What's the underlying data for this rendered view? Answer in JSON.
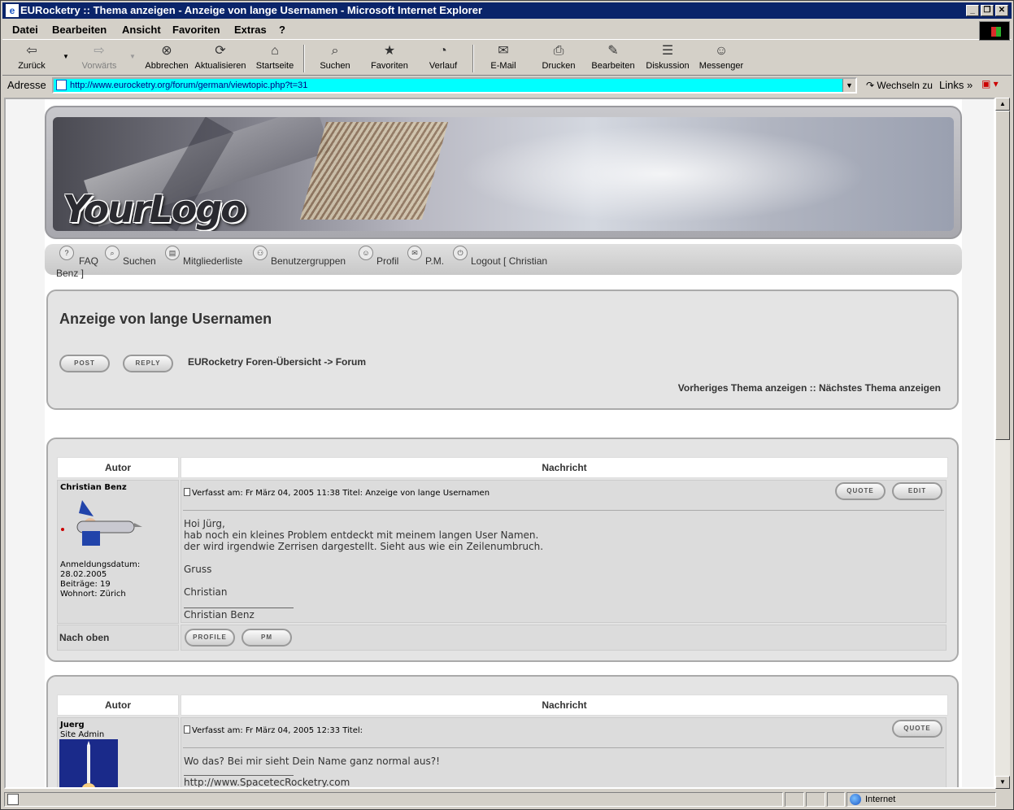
{
  "window": {
    "title": "EURocketry :: Thema anzeigen - Anzeige von lange Usernamen - Microsoft Internet Explorer",
    "min": "_",
    "restore": "❐",
    "close": "✕"
  },
  "menu": [
    "Datei",
    "Bearbeiten",
    "Ansicht",
    "Favoriten",
    "Extras",
    "?"
  ],
  "toolbar": {
    "back": "Zurück",
    "forward": "Vorwärts",
    "stop": "Abbrechen",
    "refresh": "Aktualisieren",
    "home": "Startseite",
    "search": "Suchen",
    "favorites": "Favoriten",
    "history": "Verlauf",
    "mail": "E-Mail",
    "print": "Drucken",
    "edit": "Bearbeiten",
    "discuss": "Diskussion",
    "messenger": "Messenger"
  },
  "address": {
    "label": "Adresse",
    "url": "http://www.eurocketry.org/forum/german/viewtopic.php?t=31",
    "go": "Wechseln zu",
    "links": "Links"
  },
  "status": {
    "zone": "Internet"
  },
  "site": {
    "logo": "YourLogo",
    "nav": {
      "faq": "FAQ",
      "search": "Suchen",
      "members": "Mitgliederliste",
      "groups": "Benutzergruppen",
      "profile": "Profil",
      "pm": "P.M.",
      "logout": "Logout [ Christian",
      "logout2": "Benz ]"
    }
  },
  "topic": {
    "title": "Anzeige von lange Usernamen",
    "post_btn": "POST",
    "reply_btn": "REPLY",
    "breadcrumb": "EURocketry Foren-Übersicht  -> Forum",
    "prev_next": "Vorheriges Thema anzeigen :: Nächstes Thema anzeigen"
  },
  "table": {
    "col_author": "Autor",
    "col_message": "Nachricht"
  },
  "posts": [
    {
      "author": "Christian Benz",
      "joined": "Anmeldungsdatum: 28.02.2005",
      "posts": "Beiträge: 19",
      "location": "Wohnort: Zürich",
      "header": "Verfasst am: Fr März 04, 2005 11:38     Titel: Anzeige von lange Usernamen",
      "quote": "QUOTE",
      "edit": "EDIT",
      "body": "Hoi Jürg,\nhab noch ein kleines Problem entdeckt mit meinem langen User Namen.\nder wird irgendwie Zerrisen dargestellt. Sieht aus wie ein Zeilenumbruch.\n\nGruss\n\nChristian",
      "signature": "Christian Benz",
      "back_to_top": "Nach oben",
      "profile_btn": "PROFILE",
      "pm_btn": "PM"
    },
    {
      "author": "Juerg",
      "rank": "Site Admin",
      "header": "Verfasst am: Fr März 04, 2005 12:33     Titel:",
      "quote": "QUOTE",
      "body": "Wo das? Bei mir sieht Dein Name ganz normal aus?!",
      "signature": "http://www.SpacetecRocketry.com"
    }
  ]
}
